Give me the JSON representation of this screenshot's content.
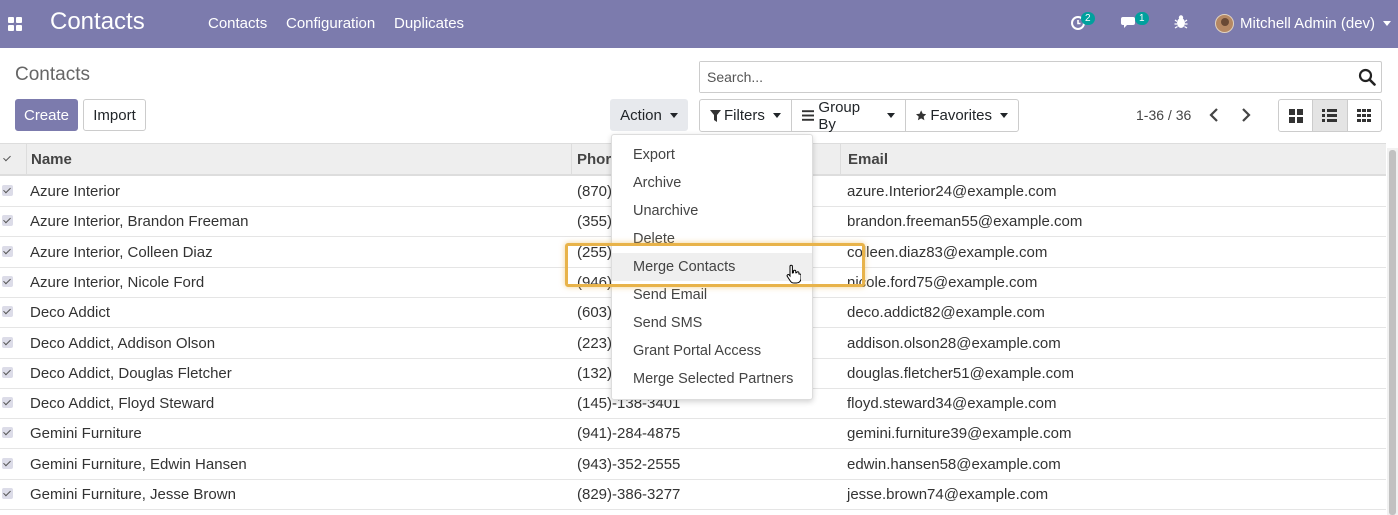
{
  "navbar": {
    "brand": "Contacts",
    "menu": [
      "Contacts",
      "Configuration",
      "Duplicates"
    ],
    "activity_count": "2",
    "messages_count": "1",
    "user": "Mitchell Admin (dev)",
    "bg_color": "#7c7bad"
  },
  "control": {
    "title": "Contacts",
    "search_placeholder": "Search...",
    "create": "Create",
    "import": "Import",
    "action": "Action",
    "filters": "Filters",
    "group_by": "Group By",
    "favorites": "Favorites",
    "pager": "1-36 / 36"
  },
  "table": {
    "headers": {
      "name": "Name",
      "phone": "Phor",
      "email": "Email"
    },
    "rows": [
      {
        "name": "Azure Interior",
        "phone": "(870)",
        "email": "azure.Interior24@example.com"
      },
      {
        "name": "Azure Interior, Brandon Freeman",
        "phone": "(355)",
        "email": "brandon.freeman55@example.com"
      },
      {
        "name": "Azure Interior, Colleen Diaz",
        "phone": "(255)",
        "email": "colleen.diaz83@example.com"
      },
      {
        "name": "Azure Interior, Nicole Ford",
        "phone": "(946)",
        "email": "nicole.ford75@example.com"
      },
      {
        "name": "Deco Addict",
        "phone": "(603)",
        "email": "deco.addict82@example.com"
      },
      {
        "name": "Deco Addict, Addison Olson",
        "phone": "(223)",
        "email": "addison.olson28@example.com"
      },
      {
        "name": "Deco Addict, Douglas Fletcher",
        "phone": "(132)",
        "email": "douglas.fletcher51@example.com"
      },
      {
        "name": "Deco Addict, Floyd Steward",
        "phone": "(145)-138-3401",
        "email": "floyd.steward34@example.com"
      },
      {
        "name": "Gemini Furniture",
        "phone": "(941)-284-4875",
        "email": "gemini.furniture39@example.com"
      },
      {
        "name": "Gemini Furniture, Edwin Hansen",
        "phone": "(943)-352-2555",
        "email": "edwin.hansen58@example.com"
      },
      {
        "name": "Gemini Furniture, Jesse Brown",
        "phone": "(829)-386-3277",
        "email": "jesse.brown74@example.com"
      }
    ]
  },
  "action_menu": {
    "items": [
      "Export",
      "Archive",
      "Unarchive",
      "Delete",
      "Merge Contacts",
      "Send Email",
      "Send SMS",
      "Grant Portal Access",
      "Merge Selected Partners"
    ],
    "hovered": "Merge Contacts",
    "highlight_color": "#e8b34a"
  }
}
